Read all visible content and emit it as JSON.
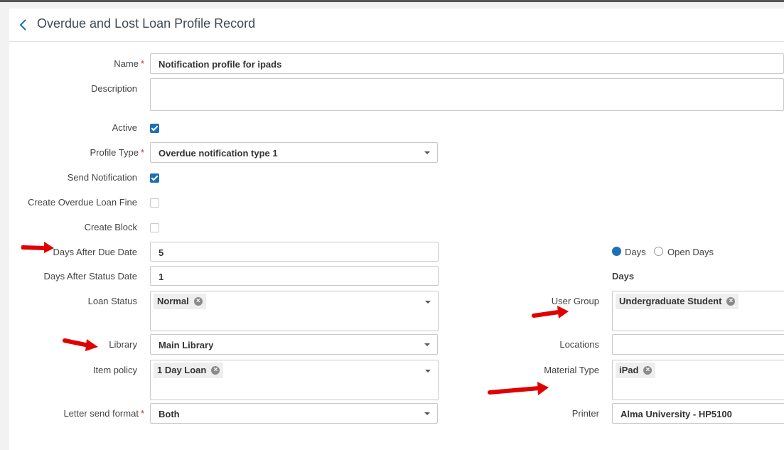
{
  "header": {
    "title": "Overdue and Lost Loan Profile Record",
    "back_icon": "chevron-left-icon"
  },
  "colors": {
    "accent": "#1d6fb8",
    "required": "#d9302c",
    "arrow": "#e00000"
  },
  "form": {
    "name": {
      "label": "Name",
      "required": "*",
      "value": "Notification profile for ipads"
    },
    "description": {
      "label": "Description",
      "value": ""
    },
    "active": {
      "label": "Active",
      "checked": true
    },
    "profile_type": {
      "label": "Profile Type",
      "required": "*",
      "value": "Overdue notification type 1"
    },
    "send_notification": {
      "label": "Send Notification",
      "checked": true
    },
    "create_overdue_loan_fine": {
      "label": "Create Overdue Loan Fine",
      "checked": false
    },
    "create_block": {
      "label": "Create Block",
      "checked": false
    },
    "days_after_due_date": {
      "label": "Days After Due Date",
      "value": "5"
    },
    "days_after_status_date": {
      "label": "Days After Status Date",
      "value": "1"
    },
    "loan_status": {
      "label": "Loan Status",
      "chips": [
        "Normal"
      ]
    },
    "library": {
      "label": "Library",
      "value": "Main Library"
    },
    "item_policy": {
      "label": "Item policy",
      "chips": [
        "1 Day Loan"
      ]
    },
    "letter_send_format": {
      "label": "Letter send format",
      "required": "*",
      "value": "Both"
    },
    "days_mode": {
      "options": [
        "Days",
        "Open Days"
      ],
      "selected": "Days",
      "caption": "Days"
    },
    "user_group": {
      "label": "User Group",
      "chips": [
        "Undergraduate Student"
      ]
    },
    "locations": {
      "label": "Locations",
      "value": ""
    },
    "material_type": {
      "label": "Material Type",
      "chips": [
        "iPad"
      ]
    },
    "printer": {
      "label": "Printer",
      "value": "Alma University - HP5100"
    }
  }
}
